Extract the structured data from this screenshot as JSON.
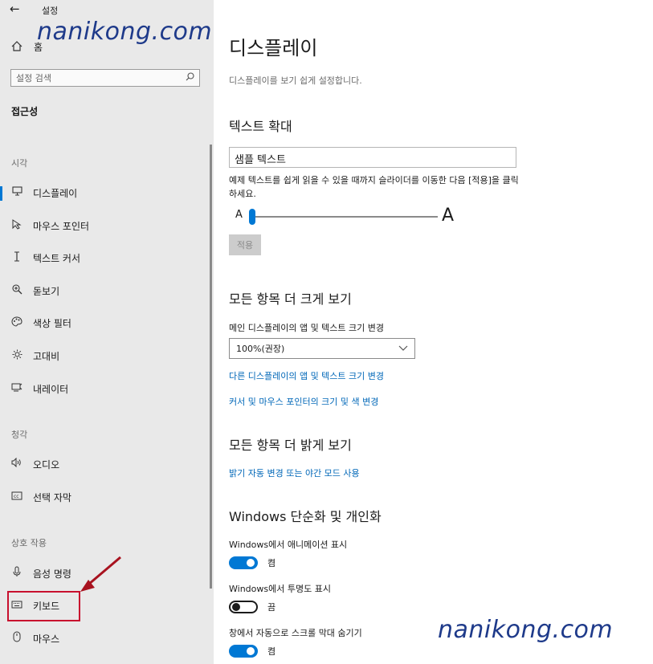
{
  "titlebar": {
    "back_glyph": "←",
    "title": "설정"
  },
  "sidebar": {
    "home_label": "홈",
    "search_placeholder": "설정 검색",
    "section_title": "접근성",
    "groups": [
      {
        "label": "시각",
        "items": [
          {
            "label": "디스플레이",
            "icon": "monitor-icon"
          },
          {
            "label": "마우스 포인터",
            "icon": "pointer-icon"
          },
          {
            "label": "텍스트 커서",
            "icon": "text-cursor-icon"
          },
          {
            "label": "돋보기",
            "icon": "magnifier-icon"
          },
          {
            "label": "색상 필터",
            "icon": "palette-icon"
          },
          {
            "label": "고대비",
            "icon": "contrast-icon"
          },
          {
            "label": "내레이터",
            "icon": "narrator-icon"
          }
        ]
      },
      {
        "label": "청각",
        "items": [
          {
            "label": "오디오",
            "icon": "speaker-icon"
          },
          {
            "label": "선택 자막",
            "icon": "captions-icon"
          }
        ]
      },
      {
        "label": "상호 작용",
        "items": [
          {
            "label": "음성 명령",
            "icon": "microphone-icon"
          },
          {
            "label": "키보드",
            "icon": "keyboard-icon"
          },
          {
            "label": "마우스",
            "icon": "mouse-icon"
          }
        ]
      }
    ]
  },
  "watermark": {
    "text": "nanikong.com"
  },
  "main": {
    "title": "디스플레이",
    "subtitle": "디스플레이를 보기 쉽게 설정합니다.",
    "text_scale": {
      "heading": "텍스트 확대",
      "sample_text": "샘플 텍스트",
      "description": "예제 텍스트를 쉽게 읽을 수 있을 때까지 슬라이더를 이동한 다음 [적용]을 클릭하세요.",
      "slider_small_label": "A",
      "slider_large_label": "A",
      "slider_value": 0,
      "apply_label": "적용"
    },
    "make_bigger": {
      "heading": "모든 항목 더 크게 보기",
      "scale_label": "메인 디스플레이의 앱 및 텍스트 크기 변경",
      "scale_value": "100%(권장)",
      "link1": "다른 디스플레이의 앱 및 텍스트 크기 변경",
      "link2": "커서 및 마우스 포인터의 크기 및 색 변경"
    },
    "make_brighter": {
      "heading": "모든 항목 더 밝게 보기",
      "link": "밝기 자동 변경 또는 야간 모드 사용"
    },
    "simplify": {
      "heading": "Windows 단순화 및 개인화",
      "toggles": [
        {
          "label": "Windows에서 애니메이션 표시",
          "state": "켬",
          "on": true
        },
        {
          "label": "Windows에서 투명도 표시",
          "state": "끔",
          "on": false
        },
        {
          "label": "창에서 자동으로 스크롤 막대 숨기기",
          "state": "켬",
          "on": true
        }
      ]
    }
  },
  "colors": {
    "accent": "#0078d4",
    "link": "#0067b8",
    "highlight": "#c8102e",
    "watermark": "#1e3a8a"
  }
}
